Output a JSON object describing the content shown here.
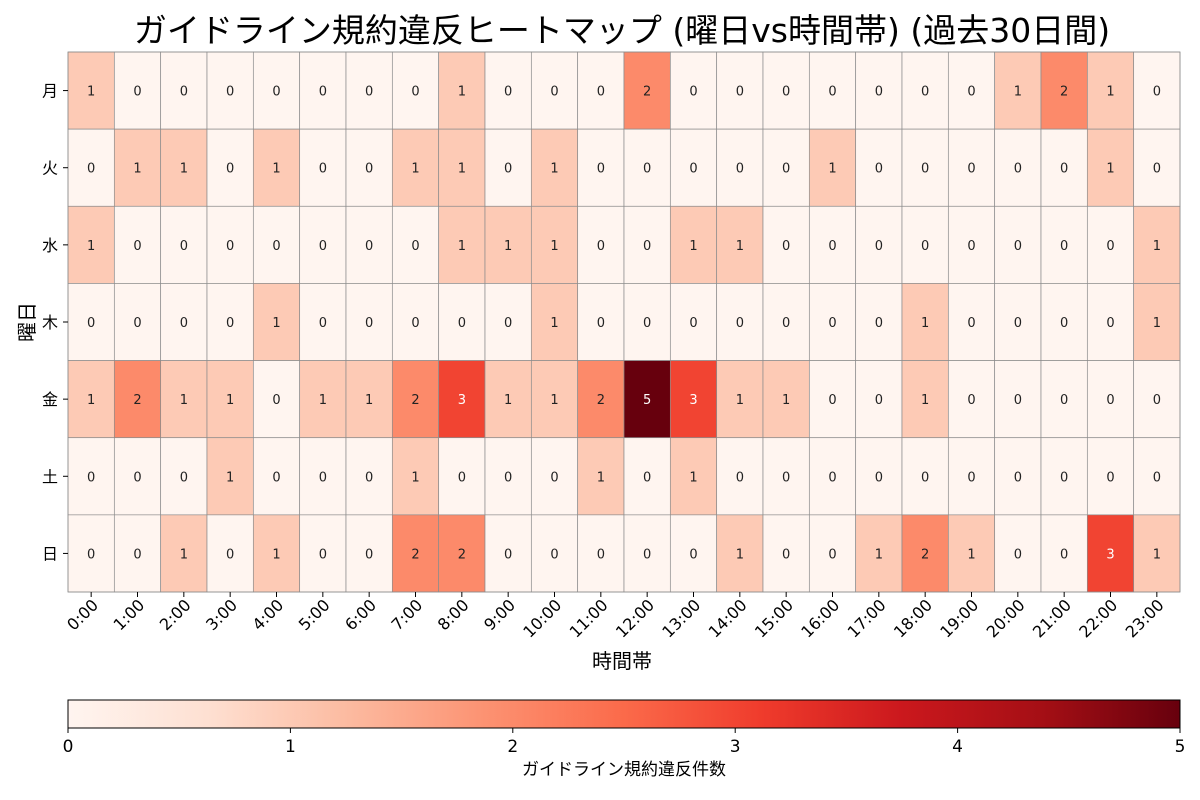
{
  "chart_data": {
    "type": "heatmap",
    "title": "ガイドライン規約違反ヒートマップ (曜日vs時間帯) (過去30日間)",
    "xlabel": "時間帯",
    "ylabel": "曜日",
    "x_categories": [
      "0:00",
      "1:00",
      "2:00",
      "3:00",
      "4:00",
      "5:00",
      "6:00",
      "7:00",
      "8:00",
      "9:00",
      "10:00",
      "11:00",
      "12:00",
      "13:00",
      "14:00",
      "15:00",
      "16:00",
      "17:00",
      "18:00",
      "19:00",
      "20:00",
      "21:00",
      "22:00",
      "23:00"
    ],
    "y_categories": [
      "月",
      "火",
      "水",
      "木",
      "金",
      "土",
      "日"
    ],
    "values": [
      [
        1,
        0,
        0,
        0,
        0,
        0,
        0,
        0,
        1,
        0,
        0,
        0,
        2,
        0,
        0,
        0,
        0,
        0,
        0,
        0,
        1,
        2,
        1,
        0
      ],
      [
        0,
        1,
        1,
        0,
        1,
        0,
        0,
        1,
        1,
        0,
        1,
        0,
        0,
        0,
        0,
        0,
        1,
        0,
        0,
        0,
        0,
        0,
        1,
        0
      ],
      [
        1,
        0,
        0,
        0,
        0,
        0,
        0,
        0,
        1,
        1,
        1,
        0,
        0,
        1,
        1,
        0,
        0,
        0,
        0,
        0,
        0,
        0,
        0,
        1
      ],
      [
        0,
        0,
        0,
        0,
        1,
        0,
        0,
        0,
        0,
        0,
        1,
        0,
        0,
        0,
        0,
        0,
        0,
        0,
        1,
        0,
        0,
        0,
        0,
        1
      ],
      [
        1,
        2,
        1,
        1,
        0,
        1,
        1,
        2,
        3,
        1,
        1,
        2,
        5,
        3,
        1,
        1,
        0,
        0,
        1,
        0,
        0,
        0,
        0,
        0
      ],
      [
        0,
        0,
        0,
        1,
        0,
        0,
        0,
        1,
        0,
        0,
        0,
        1,
        0,
        1,
        0,
        0,
        0,
        0,
        0,
        0,
        0,
        0,
        0,
        0
      ],
      [
        0,
        0,
        1,
        0,
        1,
        0,
        0,
        2,
        2,
        0,
        0,
        0,
        0,
        0,
        1,
        0,
        0,
        1,
        2,
        1,
        0,
        0,
        3,
        1
      ]
    ],
    "colormap": "Reds",
    "color_range": [
      0,
      5
    ],
    "colorbar": {
      "label": "ガイドライン規約違反件数",
      "ticks": [
        "0",
        "1",
        "2",
        "3",
        "4",
        "5"
      ],
      "orientation": "horizontal",
      "placement": "bottom"
    },
    "cell_annotations": true,
    "gridlines": true
  }
}
